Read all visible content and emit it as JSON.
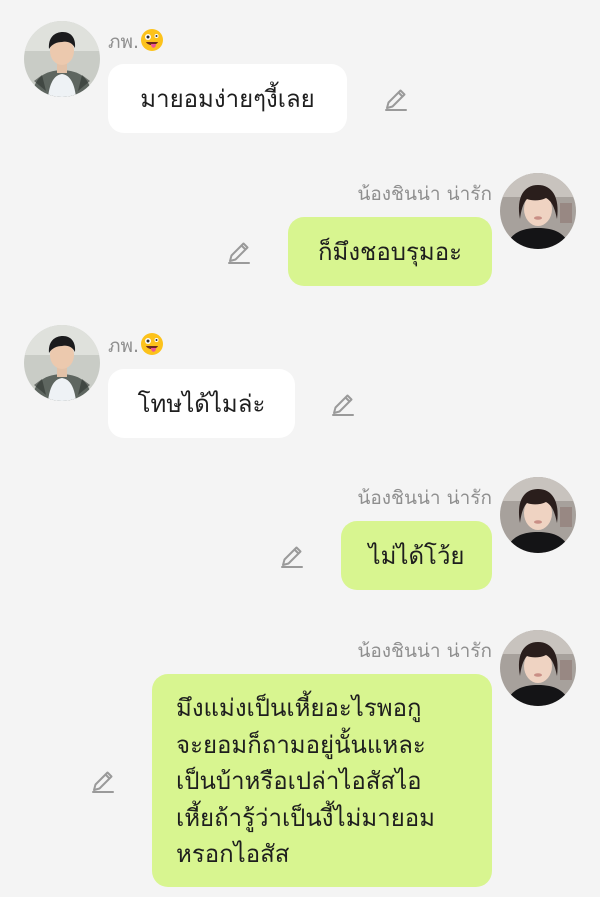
{
  "colors": {
    "background": "#f4f4f4",
    "incoming_bubble": "#ffffff",
    "outgoing_bubble": "#d8f590",
    "sender_name": "#8f8f8f",
    "message_text": "#1e1e1e",
    "edit_icon": "#9a9a9a"
  },
  "messages": [
    {
      "direction": "incoming",
      "sender": "ภพ.",
      "emoji": "zany-face-emoji",
      "lines": [
        "มายอมง่ายๆงี้เลย"
      ],
      "icons": [
        "avatar-photo-male",
        "pencil-icon"
      ]
    },
    {
      "direction": "outgoing",
      "sender": "น้องชินน่า น่ารัก",
      "lines": [
        "ก็มึงชอบรุมอะ"
      ],
      "icons": [
        "avatar-photo-female",
        "pencil-icon"
      ]
    },
    {
      "direction": "incoming",
      "sender": "ภพ.",
      "emoji": "zany-face-emoji",
      "lines": [
        "โทษได้ไมล่ะ"
      ],
      "icons": [
        "avatar-photo-male",
        "pencil-icon"
      ]
    },
    {
      "direction": "outgoing",
      "sender": "น้องชินน่า น่ารัก",
      "lines": [
        "ไม่ได้โว้ย"
      ],
      "icons": [
        "avatar-photo-female",
        "pencil-icon"
      ]
    },
    {
      "direction": "outgoing",
      "sender": "น้องชินน่า น่ารัก",
      "lines": [
        "มึงแม่งเป็นเหี้ยอะไรพอกู",
        "จะยอมก็ถามอยู่นั้นแหละ",
        "เป็นบ้าหรือเปล่าไอสัสไอ",
        "เหี้ยถ้ารู้ว่าเป็นงี้ไม่มายอม",
        "หรอกไอสัส"
      ],
      "icons": [
        "avatar-photo-female",
        "pencil-icon"
      ]
    }
  ]
}
